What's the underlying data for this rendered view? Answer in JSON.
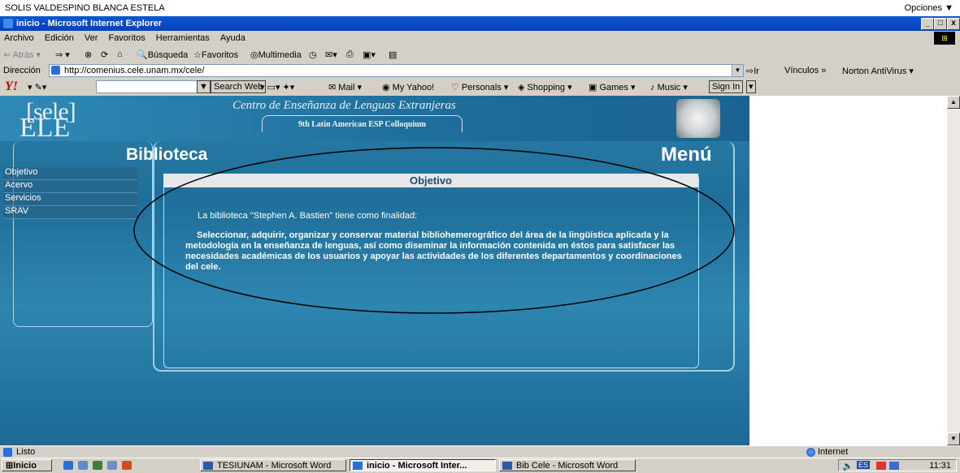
{
  "user_bar": {
    "name": "SOLIS VALDESPINO BLANCA ESTELA",
    "options": "Opciones"
  },
  "window": {
    "title": "inicio - Microsoft Internet Explorer",
    "min": "_",
    "max": "□",
    "close": "x"
  },
  "menu": [
    "Archivo",
    "Edición",
    "Ver",
    "Favoritos",
    "Herramientas",
    "Ayuda"
  ],
  "toolbar": {
    "back": "Atrás",
    "search": "Búsqueda",
    "favorites": "Favoritos",
    "multimedia": "Multimedia"
  },
  "address": {
    "label": "Dirección",
    "url": "http://comenius.cele.unam.mx/cele/",
    "go": "Ir",
    "links": "Vínculos",
    "norton": "Norton AntiVirus"
  },
  "yahoo_bar": {
    "logo": "Y!",
    "search_web": "Search Web",
    "mail": "Mail",
    "my_yahoo": "My Yahoo!",
    "personals": "Personals",
    "shopping": "Shopping",
    "games": "Games",
    "music": "Music",
    "sign_in": "Sign In"
  },
  "page": {
    "logo_top": "[sele]",
    "logo_bottom": "ELE",
    "center_title": "Centro de Enseñanza de Lenguas Extranjeras",
    "colloquium": "9th Latin American ESP Colloquium",
    "section_title": "Biblioteca",
    "menu_title": "Menú",
    "nav": [
      "Objetivo",
      "Acervo",
      "Servicios",
      "SRAV"
    ],
    "panel_title": "Objetivo",
    "intro": "La biblioteca \"Stephen A. Bastien\" tiene como finalidad:",
    "body": "Seleccionar, adquirir, organizar y conservar material bibliohemerográfico del área de la lingüística aplicada y la metodología en la enseñanza de lenguas, así como diseminar la información contenida en éstos para satisfacer las necesidades académicas de los usuarios y apoyar las actividades de los diferentes departamentos y coordinaciones del cele."
  },
  "status": {
    "text": "Listo",
    "zone": "Internet"
  },
  "taskbar": {
    "start": "Inicio",
    "tasks": [
      "TESIUNAM - Microsoft Word",
      "inicio - Microsoft Inter...",
      "Bib Cele - Microsoft Word"
    ],
    "lang": "ES",
    "clock": "11:31"
  },
  "colors": {
    "title_blue": "#0a58d6",
    "page_blue": "#2b7fa8",
    "chrome": "#d4d0c8"
  }
}
